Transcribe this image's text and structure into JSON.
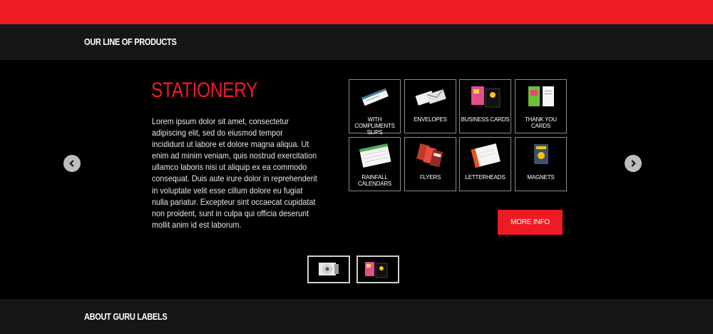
{
  "header": {
    "section_title": "OUR LINE OF PRODUCTS"
  },
  "product": {
    "title": "STATIONERY",
    "description": "Lorem ipsum dolor sit amet, consectetur adipiscing elit, sed do eiusmod tempor incididunt ut labore et dolore magna aliqua. Ut enim ad minim veniam, quis nostrud exercitation ullamco laboris nisi ut aliquip ex ea commodo consequat. Duis aute irure dolor in reprehenderit in voluptate velit esse cillum dolore eu fugiat nulla pariatur. Excepteur sint occaecat cupidatat non proident, sunt in culpa qui officia deserunt mollit anim id est laborum.",
    "tiles": [
      {
        "label": "WITH COMPLIMENTS SLIPS",
        "icon": "compliment-slips-icon"
      },
      {
        "label": "ENVELOPES",
        "icon": "envelopes-icon"
      },
      {
        "label": "BUSINESS CARDS",
        "icon": "business-cards-icon"
      },
      {
        "label": "THANK YOU CARDS",
        "icon": "thank-you-cards-icon"
      },
      {
        "label": "RAINFALL CALENDARS",
        "icon": "calendar-icon"
      },
      {
        "label": "FLYERS",
        "icon": "flyers-icon"
      },
      {
        "label": "LETTERHEADS",
        "icon": "letterhead-icon"
      },
      {
        "label": "MAGNETS",
        "icon": "magnets-icon"
      }
    ],
    "more_info_label": "MORE INFO"
  },
  "slider_nav": {
    "prev_icon": "chevron-left-icon",
    "next_icon": "chevron-right-icon",
    "thumbnails": [
      "label-roll-thumbnail",
      "business-cards-thumbnail"
    ]
  },
  "footer_section": {
    "title": "ABOUT GURU LABELS"
  },
  "colors": {
    "accent": "#ed1c24",
    "header_bg": "#161616",
    "page_bg": "#000000",
    "tile_border": "#8a8a8a"
  }
}
